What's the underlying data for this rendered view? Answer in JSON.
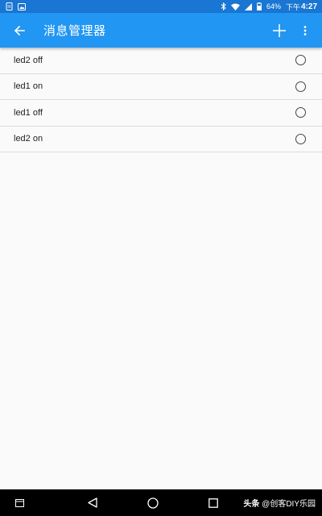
{
  "status_bar": {
    "battery": "64%",
    "time_prefix": "下午",
    "time": "4:27"
  },
  "app_bar": {
    "title": "消息管理器"
  },
  "messages": [
    {
      "label": "led2 off",
      "selected": false
    },
    {
      "label": "led1 on",
      "selected": false
    },
    {
      "label": "led1 off",
      "selected": false
    },
    {
      "label": "led2 on",
      "selected": false
    }
  ],
  "watermark": {
    "brand": "头条",
    "handle": "@创客DIY乐园"
  },
  "colors": {
    "app_bar": "#2196f3",
    "status_bar": "#1976d2",
    "background": "#fafafa"
  },
  "icons": {
    "back": "arrow-left-icon",
    "add": "plus-icon",
    "more": "more-vert-icon"
  }
}
